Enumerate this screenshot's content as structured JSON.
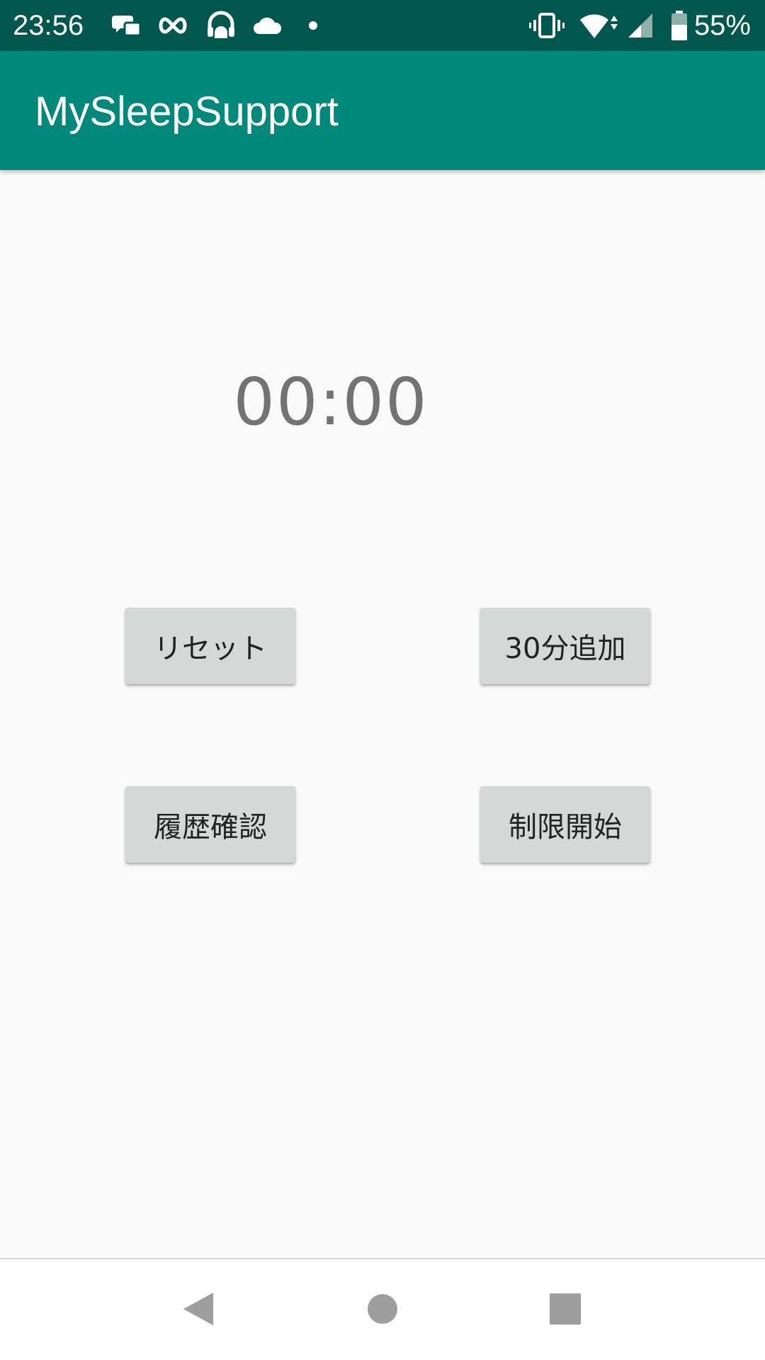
{
  "status_bar": {
    "time": "23:56",
    "battery_percent": "55%",
    "icons": [
      "messaging-icon",
      "infinity-icon",
      "headphones-android-icon",
      "cloud-icon",
      "dot-icon",
      "vibrate-icon",
      "wifi-icon",
      "signal-icon",
      "battery-icon"
    ],
    "background_color": "#00574e"
  },
  "app_bar": {
    "title": "MySleepSupport",
    "background_color": "#00897b"
  },
  "timer": {
    "display": "00:00"
  },
  "buttons": {
    "reset_label": "リセット",
    "add30_label": "30分追加",
    "history_label": "履歴確認",
    "start_label": "制限開始"
  },
  "nav_bar": {
    "icons": [
      "back-icon",
      "home-icon",
      "recents-icon"
    ]
  }
}
